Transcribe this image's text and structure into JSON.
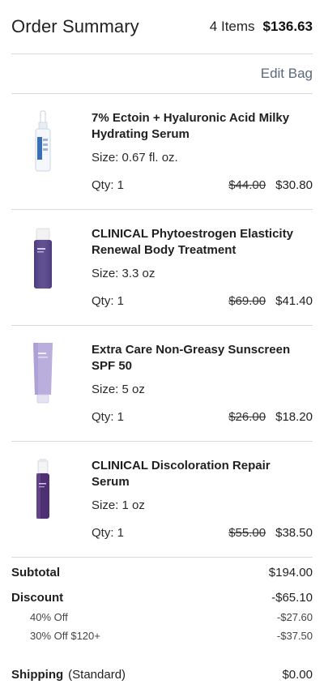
{
  "header": {
    "title": "Order Summary",
    "item_count": "4 Items",
    "total": "$136.63"
  },
  "edit_bag": "Edit Bag",
  "items": [
    {
      "name": "7% Ectoin + Hyaluronic Acid Milky Hydrating Serum",
      "size": "Size: 0.67 fl. oz.",
      "qty": "Qty: 1",
      "original_price": "$44.00",
      "sale_price": "$30.80"
    },
    {
      "name": "CLINICAL Phytoestrogen Elasticity Renewal Body Treatment",
      "size": "Size: 3.3 oz",
      "qty": "Qty: 1",
      "original_price": "$69.00",
      "sale_price": "$41.40"
    },
    {
      "name": "Extra Care Non-Greasy Sunscreen SPF 50",
      "size": "Size: 5 oz",
      "qty": "Qty: 1",
      "original_price": "$26.00",
      "sale_price": "$18.20"
    },
    {
      "name": "CLINICAL Discoloration Repair Serum",
      "size": "Size: 1 oz",
      "qty": "Qty: 1",
      "original_price": "$55.00",
      "sale_price": "$38.50"
    }
  ],
  "totals": {
    "subtotal_label": "Subtotal",
    "subtotal": "$194.00",
    "discount_label": "Discount",
    "discount": "-$65.10",
    "discounts": [
      {
        "label": "40% Off",
        "value": "-$27.60"
      },
      {
        "label": "30% Off $120+",
        "value": "-$37.50"
      }
    ],
    "shipping_label": "Shipping",
    "shipping_type": "(Standard)",
    "shipping": "$0.00"
  },
  "colors": {
    "link": "#5b6a7d",
    "divider": "#d9d9d9",
    "text": "#1f1f1f"
  }
}
